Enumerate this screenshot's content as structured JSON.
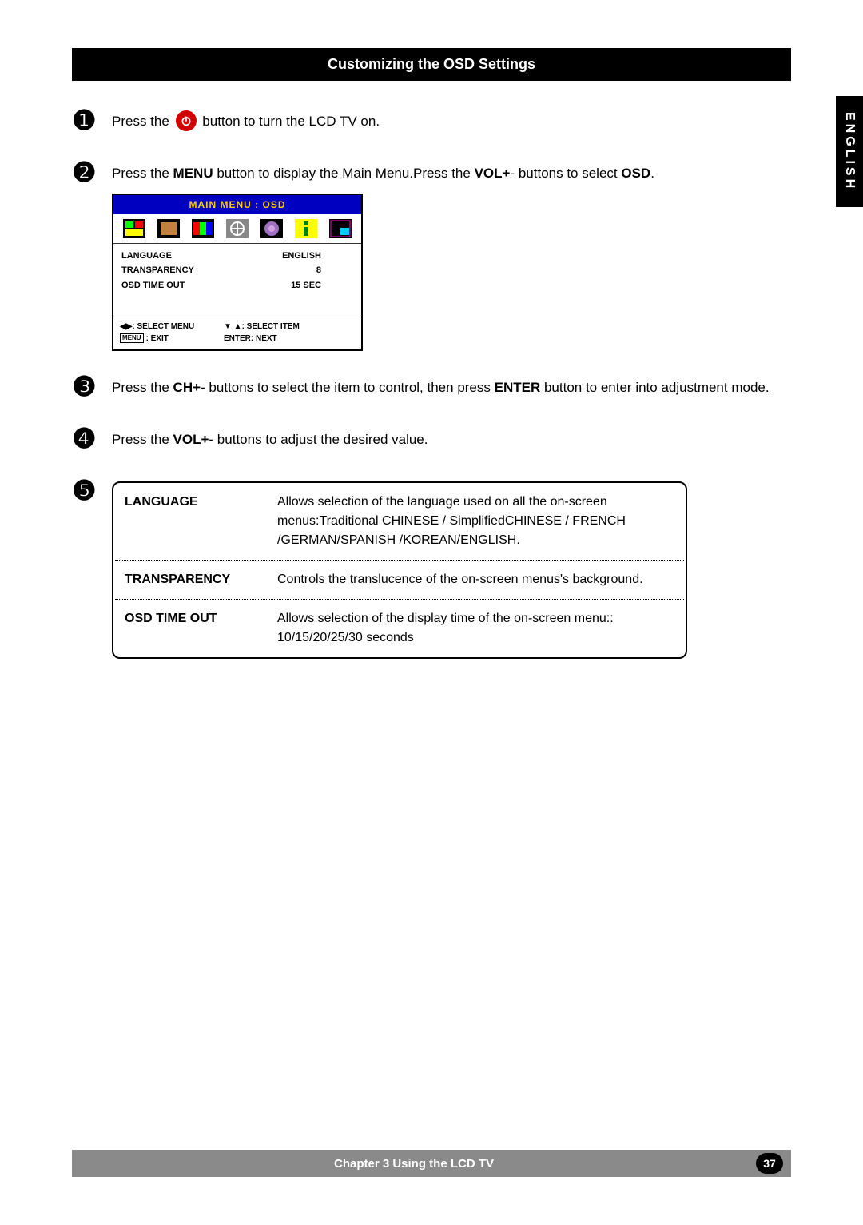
{
  "title": "Customizing the OSD Settings",
  "language_tab": "ENGLISH",
  "steps": {
    "s1": {
      "num": "❶",
      "pre": "Press the ",
      "post": " button to turn the LCD TV on."
    },
    "s2": {
      "num": "❷",
      "t1": "Press the ",
      "menu": "MENU",
      "t2": " button to display the Main Menu.Press the ",
      "vol": "VOL+",
      "t3": "- buttons to select ",
      "osd": "OSD",
      "t4": "."
    },
    "s3": {
      "num": "❸",
      "t1": "Press the ",
      "ch": "CH+",
      "t2": "- buttons to select the item to control, then press ",
      "enter": "ENTER",
      "t3": " button to enter into adjustment mode."
    },
    "s4": {
      "num": "❹",
      "t1": "Press the ",
      "vol": "VOL+",
      "t2": "- buttons to adjust the desired value."
    },
    "s5": {
      "num": "❺"
    }
  },
  "osd_menu": {
    "title": "MAIN MENU : OSD",
    "rows": [
      {
        "label": "LANGUAGE",
        "value": "ENGLISH"
      },
      {
        "label": "TRANSPARENCY",
        "value": "8"
      },
      {
        "label": "OSD TIME OUT",
        "value": "15 SEC"
      }
    ],
    "hints": {
      "select_menu": ": SELECT MENU",
      "select_item": ": SELECT ITEM",
      "exit": ": EXIT",
      "enter_next": "ENTER: NEXT",
      "menu_box": "MENU"
    }
  },
  "desc_table": [
    {
      "label": "LANGUAGE",
      "desc": "Allows selection of the language used on all the on-screen menus:Traditional CHINESE / SimplifiedCHINESE / FRENCH /GERMAN/SPANISH /KOREAN/ENGLISH."
    },
    {
      "label": "TRANSPARENCY",
      "desc": "Controls the translucence of the on-screen menus's background."
    },
    {
      "label": "OSD TIME OUT",
      "desc": "Allows selection of the display time of the on-screen menu:: 10/15/20/25/30 seconds"
    }
  ],
  "footer": {
    "text": "Chapter 3 Using the LCD TV",
    "page": "37"
  }
}
